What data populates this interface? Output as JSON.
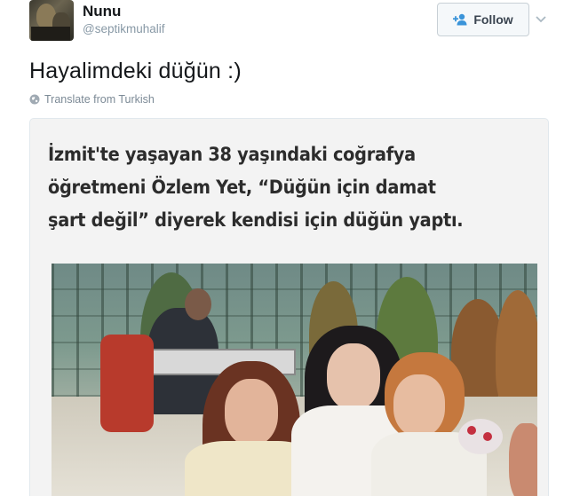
{
  "tweet": {
    "author": {
      "name": "Nunu",
      "handle": "@septikmuhalif"
    },
    "follow_label": "Follow",
    "text": "Hayalimdeki düğün :)",
    "translate_label": "Translate from Turkish"
  },
  "media": {
    "headline_lines": [
      "İzmit'te yaşayan 38 yaşındaki coğrafya",
      "öğretmeni Özlem Yet, “Düğün için damat",
      "şart değil” diyerek kendisi için düğün yaptı."
    ]
  },
  "icons": {
    "follow": "add-user-icon",
    "caret": "chevron-down-icon",
    "translate": "globe-icon"
  },
  "colors": {
    "name": "#14171a",
    "secondary": "#8899a6",
    "button_bg": "#f5f8fa",
    "button_border": "#c8d0d6"
  }
}
